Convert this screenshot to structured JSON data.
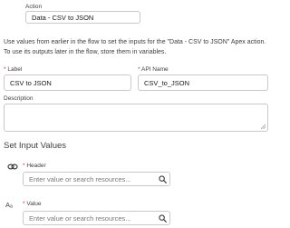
{
  "action": {
    "label": "Action",
    "value": "Data - CSV to JSON"
  },
  "description_text": "Use values from earlier in the flow to set the inputs for the \"Data - CSV to JSON\" Apex action. To use its outputs later in the flow, store them in variables.",
  "fields": {
    "label": {
      "required_mark": "*",
      "name": "Label",
      "value": "CSV to JSON"
    },
    "api_name": {
      "required_mark": "*",
      "name": "API Name",
      "value": "CSV_to_JSON"
    },
    "description": {
      "name": "Description",
      "value": ""
    }
  },
  "inputs_section": {
    "title": "Set Input Values",
    "rows": [
      {
        "icon": "link-icon",
        "required_mark": "*",
        "name": "Header",
        "placeholder": "Enter value or search resources..."
      },
      {
        "icon": "text-type-icon",
        "icon_text": "Aₐ",
        "required_mark": "*",
        "name": "Value",
        "placeholder": "Enter value or search resources..."
      }
    ]
  },
  "colors": {
    "required": "#c23934",
    "border": "#c9c9c9",
    "text": "#3e3e3c"
  }
}
